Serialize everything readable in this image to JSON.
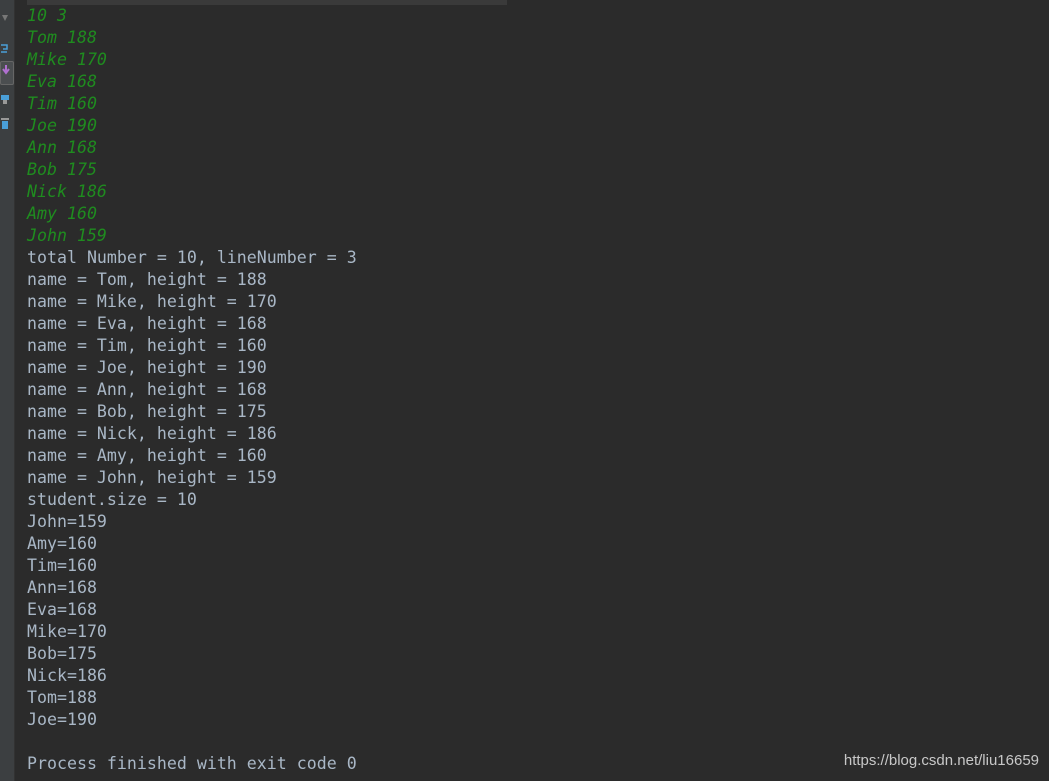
{
  "console": {
    "input_lines": [
      "10 3",
      "Tom 188",
      "Mike 170",
      "Eva 168",
      "Tim 160",
      "Joe 190",
      "Ann 168",
      "Bob 175",
      "Nick 186",
      "Amy 160",
      "John 159"
    ],
    "output_lines": [
      "total Number = 10, lineNumber = 3",
      "name = Tom, height = 188",
      "name = Mike, height = 170",
      "name = Eva, height = 168",
      "name = Tim, height = 160",
      "name = Joe, height = 190",
      "name = Ann, height = 168",
      "name = Bob, height = 175",
      "name = Nick, height = 186",
      "name = Amy, height = 160",
      "name = John, height = 159",
      "student.size = 10",
      "John=159",
      "Amy=160",
      "Tim=160",
      "Ann=168",
      "Eva=168",
      "Mike=170",
      "Bob=175",
      "Nick=186",
      "Tom=188",
      "Joe=190",
      "",
      "Process finished with exit code 0"
    ]
  },
  "sidebar": {
    "icons": [
      "scroll-down-icon",
      "soft-wrap-icon",
      "scroll-to-end-icon",
      "print-icon",
      "trash-icon"
    ]
  },
  "watermark": "https://blog.csdn.net/liu16659",
  "colors": {
    "background": "#2b2b2b",
    "input_text": "#1f8c1f",
    "output_text": "#a9b7c6"
  }
}
